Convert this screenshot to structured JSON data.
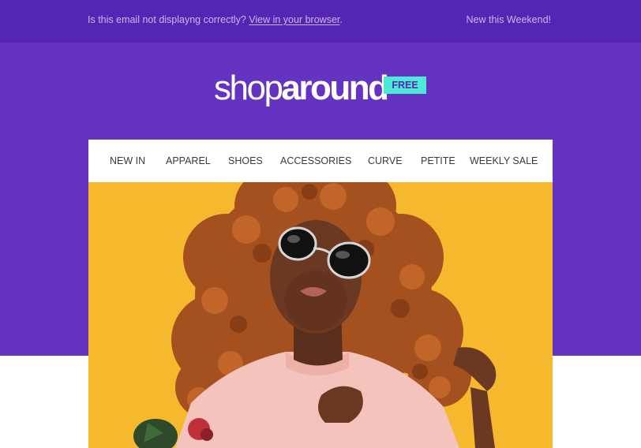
{
  "preheader": {
    "notice_text": "Is this email not displayng correctly?",
    "view_link": "View in your browser",
    "period": ".",
    "promo": "New this Weekend!"
  },
  "brand": {
    "logo_thin": "shop",
    "logo_bold": "around",
    "badge": "FREE"
  },
  "nav": {
    "items": [
      {
        "label": "NEW IN"
      },
      {
        "label": "APPAREL"
      },
      {
        "label": "SHOES"
      },
      {
        "label": "ACCESSORIES"
      },
      {
        "label": "CURVE"
      },
      {
        "label": "PETITE"
      },
      {
        "label": "WEEKLY SALE"
      }
    ]
  },
  "hero": {
    "image_icon": "woman-with-sunglasses-photo"
  },
  "colors": {
    "topbar": "#5526b4",
    "brand_purple": "#6433c2",
    "badge_teal": "#4ee8d6",
    "photo_yellow": "#f6b92d"
  }
}
